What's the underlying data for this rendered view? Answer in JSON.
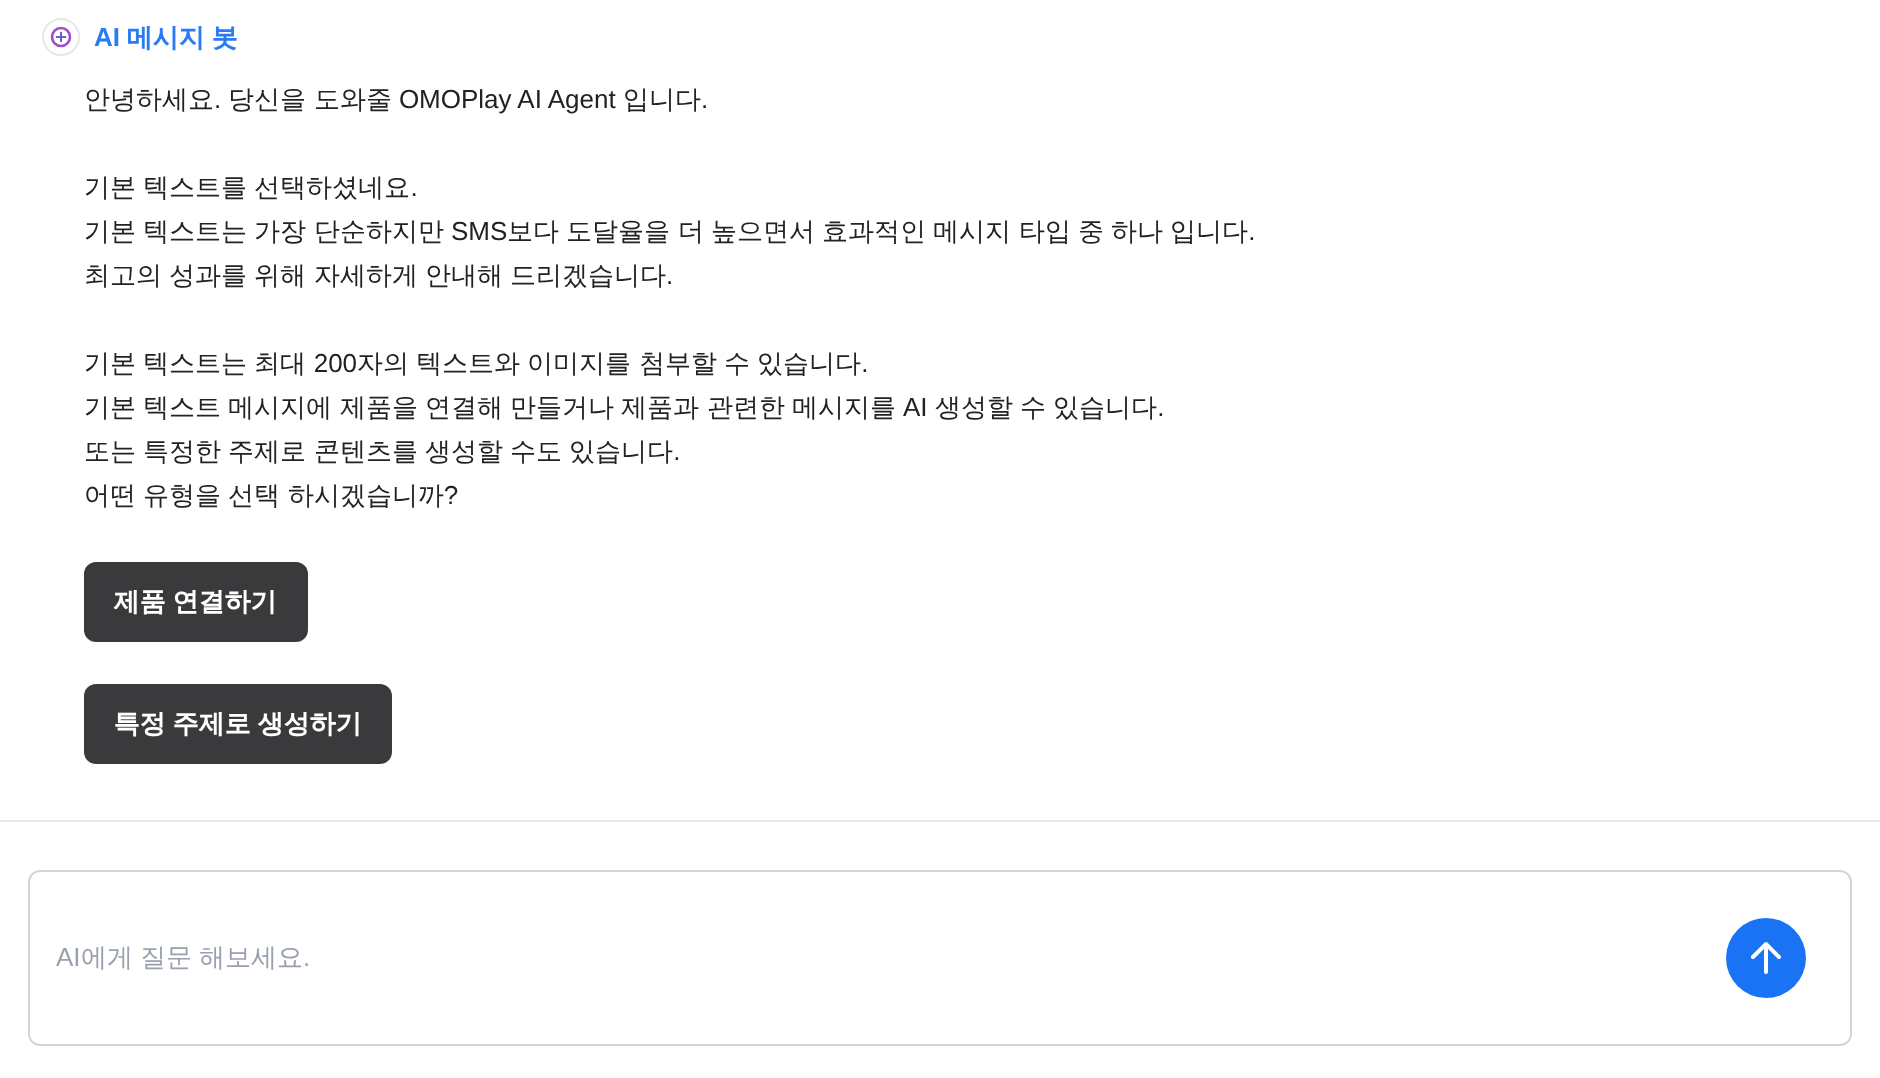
{
  "bot": {
    "name": "AI 메시지 봇"
  },
  "message": {
    "paragraphs": [
      [
        "안녕하세요. 당신을 도와줄 OMOPlay AI Agent 입니다."
      ],
      [
        "기본 텍스트를 선택하셨네요.",
        "기본 텍스트는 가장 단순하지만 SMS보다 도달율을 더 높으면서 효과적인 메시지 타입 중 하나 입니다.",
        "최고의 성과를 위해 자세하게 안내해 드리겠습니다."
      ],
      [
        "기본 텍스트는 최대 200자의 텍스트와 이미지를 첨부할 수 있습니다.",
        "기본 텍스트 메시지에 제품을 연결해 만들거나 제품과 관련한 메시지를 AI 생성할 수 있습니다.",
        "또는 특정한 주제로 콘텐츠를 생성할 수도 있습니다.",
        "어떤 유형을 선택 하시겠습니까?"
      ]
    ],
    "options": [
      "제품 연결하기",
      "특정 주제로 생성하기"
    ]
  },
  "input": {
    "placeholder": "AI에게 질문 해보세요."
  }
}
